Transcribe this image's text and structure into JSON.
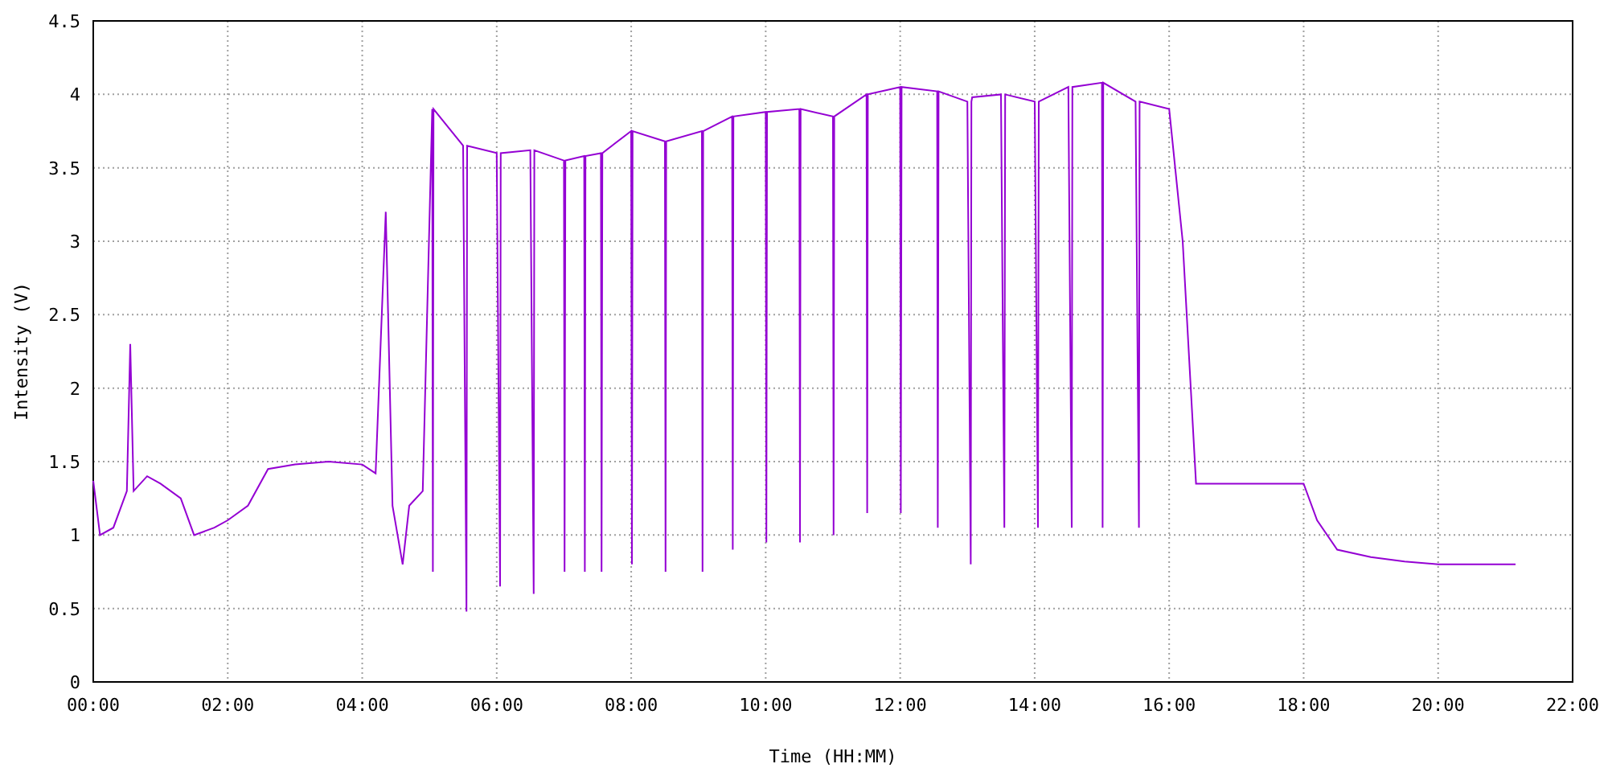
{
  "chart": {
    "chart_data": {
      "type": "line",
      "xlabel": "Time (HH:MM)",
      "ylabel": "Intensity (V)",
      "xlim": [
        0,
        22
      ],
      "ylim": [
        0,
        4.5
      ],
      "xticks": [
        {
          "value": 0,
          "label": "00:00"
        },
        {
          "value": 2,
          "label": "02:00"
        },
        {
          "value": 4,
          "label": "04:00"
        },
        {
          "value": 6,
          "label": "06:00"
        },
        {
          "value": 8,
          "label": "08:00"
        },
        {
          "value": 10,
          "label": "10:00"
        },
        {
          "value": 12,
          "label": "12:00"
        },
        {
          "value": 14,
          "label": "14:00"
        },
        {
          "value": 16,
          "label": "16:00"
        },
        {
          "value": 18,
          "label": "18:00"
        },
        {
          "value": 20,
          "label": "20:00"
        },
        {
          "value": 22,
          "label": "22:00"
        }
      ],
      "yticks": [
        0,
        0.5,
        1,
        1.5,
        2,
        2.5,
        3,
        3.5,
        4,
        4.5
      ],
      "x": [
        0,
        0.1,
        0.3,
        0.5,
        0.55,
        0.6,
        0.8,
        1.0,
        1.3,
        1.5,
        1.8,
        2.0,
        2.3,
        2.6,
        3.0,
        3.5,
        4.0,
        4.2,
        4.35,
        4.45,
        4.6,
        4.7,
        4.9,
        5.04,
        5.05,
        5.06,
        5.5,
        5.55,
        5.56,
        6.0,
        6.05,
        6.06,
        6.5,
        6.55,
        6.56,
        7.0,
        7.01,
        7.02,
        7.3,
        7.31,
        7.32,
        7.55,
        7.56,
        7.57,
        8.0,
        8.01,
        8.02,
        8.5,
        8.51,
        8.52,
        9.05,
        9.06,
        9.07,
        9.5,
        9.51,
        9.52,
        10.0,
        10.01,
        10.02,
        10.5,
        10.51,
        10.52,
        11.0,
        11.01,
        11.02,
        11.5,
        11.51,
        11.52,
        12.0,
        12.01,
        12.02,
        12.55,
        12.56,
        12.57,
        13.0,
        13.05,
        13.06,
        13.07,
        13.5,
        13.55,
        13.56,
        14.0,
        14.05,
        14.06,
        14.5,
        14.55,
        14.56,
        15.0,
        15.01,
        15.02,
        15.5,
        15.55,
        15.56,
        16.0,
        16.2,
        16.4,
        17.0,
        18.0,
        18.2,
        18.5,
        19.0,
        19.5,
        20.0,
        21.0,
        21.15
      ],
      "grid": true,
      "series": [
        {
          "color": "#9400d3",
          "values": [
            1.37,
            1.0,
            1.05,
            1.3,
            2.3,
            1.3,
            1.4,
            1.35,
            1.25,
            1.0,
            1.05,
            1.1,
            1.2,
            1.45,
            1.48,
            1.5,
            1.48,
            1.42,
            3.2,
            1.2,
            0.8,
            1.2,
            1.3,
            3.9,
            0.75,
            3.9,
            3.65,
            0.48,
            3.65,
            3.6,
            0.65,
            3.6,
            3.62,
            0.6,
            3.62,
            3.55,
            0.75,
            3.55,
            3.58,
            0.75,
            3.58,
            3.6,
            0.75,
            3.6,
            3.75,
            0.8,
            3.75,
            3.68,
            0.75,
            3.68,
            3.75,
            0.75,
            3.75,
            3.85,
            0.9,
            3.85,
            3.88,
            0.95,
            3.88,
            3.9,
            0.95,
            3.9,
            3.85,
            1.0,
            3.85,
            4.0,
            1.15,
            4.0,
            4.05,
            1.15,
            4.05,
            4.02,
            1.05,
            4.02,
            3.95,
            0.8,
            3.95,
            3.98,
            4.0,
            1.05,
            4.0,
            3.95,
            1.05,
            3.95,
            4.05,
            1.05,
            4.05,
            4.08,
            1.05,
            4.08,
            3.95,
            1.05,
            3.95,
            3.9,
            3.0,
            1.35,
            1.35,
            1.35,
            1.1,
            0.9,
            0.85,
            0.82,
            0.8,
            0.8,
            0.8
          ]
        }
      ]
    }
  }
}
